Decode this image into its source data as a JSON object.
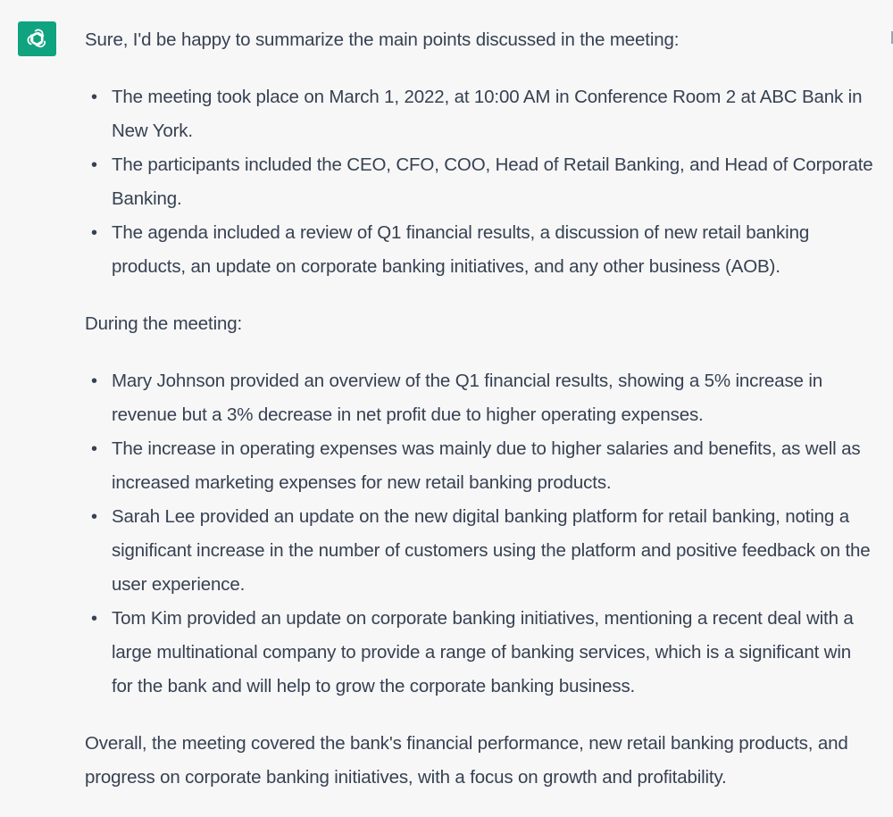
{
  "assistant": {
    "avatar_icon": "openai-logo-icon",
    "avatar_color": "#10a37f"
  },
  "message": {
    "intro": "Sure, I'd be happy to summarize the main points discussed in the meeting:",
    "summary_items": [
      "The meeting took place on March 1, 2022, at 10:00 AM in Conference Room 2 at ABC Bank in New York.",
      "The participants included the CEO, CFO, COO, Head of Retail Banking, and Head of Corporate Banking.",
      "The agenda included a review of Q1 financial results, a discussion of new retail banking products, an update on corporate banking initiatives, and any other business (AOB)."
    ],
    "during_heading": "During the meeting:",
    "during_items": [
      "Mary Johnson provided an overview of the Q1 financial results, showing a 5% increase in revenue but a 3% decrease in net profit due to higher operating expenses.",
      "The increase in operating expenses was mainly due to higher salaries and benefits, as well as increased marketing expenses for new retail banking products.",
      "Sarah Lee provided an update on the new digital banking platform for retail banking, noting a significant increase in the number of customers using the platform and positive feedback on the user experience.",
      "Tom Kim provided an update on corporate banking initiatives, mentioning a recent deal with a large multinational company to provide a range of banking services, which is a significant win for the bank and will help to grow the corporate banking business."
    ],
    "conclusion": "Overall, the meeting covered the bank's financial performance, new retail banking products, and progress on corporate banking initiatives, with a focus on growth and profitability."
  }
}
